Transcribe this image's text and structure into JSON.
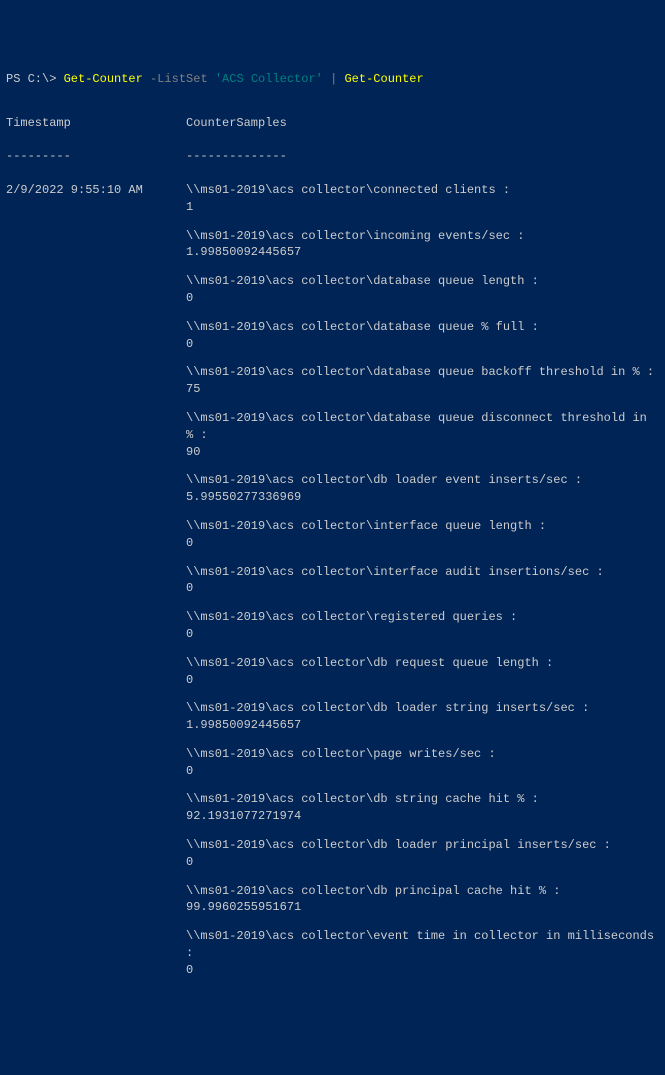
{
  "prompt": {
    "ps": "PS C:\\> ",
    "cmd1": "Get-Counter",
    "param": " -ListSet ",
    "arg": "'ACS Collector'",
    "spacer": " ",
    "pipe": "|",
    "spacer2": " ",
    "cmd2": "Get-Counter"
  },
  "headers": {
    "timestamp": "Timestamp",
    "counter": "CounterSamples",
    "timestamp_div": "---------",
    "counter_div": "--------------"
  },
  "timestamp": "2/9/2022 9:55:10 AM",
  "samples": [
    {
      "path": "\\\\ms01-2019\\acs collector\\connected clients :",
      "value": "1"
    },
    {
      "path": "\\\\ms01-2019\\acs collector\\incoming events/sec :",
      "value": "1.99850092445657"
    },
    {
      "path": "\\\\ms01-2019\\acs collector\\database queue length :",
      "value": "0"
    },
    {
      "path": "\\\\ms01-2019\\acs collector\\database queue % full :",
      "value": "0"
    },
    {
      "path": "\\\\ms01-2019\\acs collector\\database queue backoff threshold in % :",
      "value": "75"
    },
    {
      "path": "\\\\ms01-2019\\acs collector\\database queue disconnect threshold in % :",
      "value": "90"
    },
    {
      "path": "\\\\ms01-2019\\acs collector\\db loader event inserts/sec :",
      "value": "5.99550277336969"
    },
    {
      "path": "\\\\ms01-2019\\acs collector\\interface queue length :",
      "value": "0"
    },
    {
      "path": "\\\\ms01-2019\\acs collector\\interface audit insertions/sec :",
      "value": "0"
    },
    {
      "path": "\\\\ms01-2019\\acs collector\\registered queries :",
      "value": "0"
    },
    {
      "path": "\\\\ms01-2019\\acs collector\\db request queue length :",
      "value": "0"
    },
    {
      "path": "\\\\ms01-2019\\acs collector\\db loader string inserts/sec :",
      "value": "1.99850092445657"
    },
    {
      "path": "\\\\ms01-2019\\acs collector\\page writes/sec :",
      "value": "0"
    },
    {
      "path": "\\\\ms01-2019\\acs collector\\db string cache hit % :",
      "value": "92.1931077271974"
    },
    {
      "path": "\\\\ms01-2019\\acs collector\\db loader principal inserts/sec :",
      "value": "0"
    },
    {
      "path": "\\\\ms01-2019\\acs collector\\db principal cache hit % :",
      "value": "99.9960255951671"
    },
    {
      "path": "\\\\ms01-2019\\acs collector\\event time in collector in milliseconds :",
      "value": "0"
    }
  ]
}
